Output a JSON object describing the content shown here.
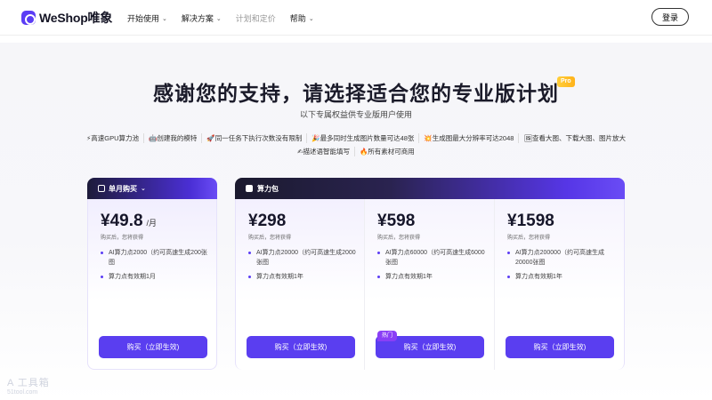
{
  "nav": {
    "logo": "WeShop唯象",
    "menu": [
      {
        "label": "开始使用",
        "has_dropdown": true
      },
      {
        "label": "解决方案",
        "has_dropdown": true
      },
      {
        "label": "计划和定价",
        "has_dropdown": false,
        "active": true
      },
      {
        "label": "帮助",
        "has_dropdown": true
      }
    ],
    "login": "登录"
  },
  "hero": {
    "title": "感谢您的支持，请选择适合您的专业版计划",
    "badge": "Pro",
    "subtitle": "以下专属权益供专业版用户使用"
  },
  "features": [
    [
      "⚡高速GPU算力池",
      "🤖创建我的模特",
      "🚀同一任务下执行次数没有限制",
      "🎉最多同时生成图片数量可达48张",
      "💥生成图最大分辨率可达2048",
      "🖼查看大图、下载大图、图片放大"
    ],
    [
      "✍描述语智能填写",
      "🔥所有素材可商用"
    ]
  ],
  "monthly": {
    "header": "单月购买",
    "price": "¥49.8",
    "unit": "/月",
    "note": "购买后，您将获得",
    "benefits": [
      "AI算力点2000（约可高速生成200张图",
      "算力点有效期1月"
    ],
    "button": "购买（立即生效)"
  },
  "packs": {
    "header": "算力包",
    "items": [
      {
        "price": "¥298",
        "note": "购买后，您将获得",
        "benefits": [
          "AI算力点20000（约可高速生成2000张图",
          "算力点有效期1年"
        ],
        "button": "购买（立即生效)",
        "tag": ""
      },
      {
        "price": "¥598",
        "note": "购买后，您将获得",
        "benefits": [
          "AI算力点60000（约可高速生成6000张图",
          "算力点有效期1年"
        ],
        "button": "购买（立即生效)",
        "tag": "热门"
      },
      {
        "price": "¥1598",
        "note": "购买后，您将获得",
        "benefits": [
          "AI算力点200000（约可高速生成20000张图",
          "算力点有效期1年"
        ],
        "button": "购买（立即生效)",
        "tag": ""
      }
    ]
  },
  "watermark": {
    "line1": "A 工具箱",
    "line2": "51tool.com"
  },
  "colors": {
    "accent": "#5a3ef0",
    "hot_tag": "#8a3ff6",
    "badge": "#ffb21a"
  }
}
